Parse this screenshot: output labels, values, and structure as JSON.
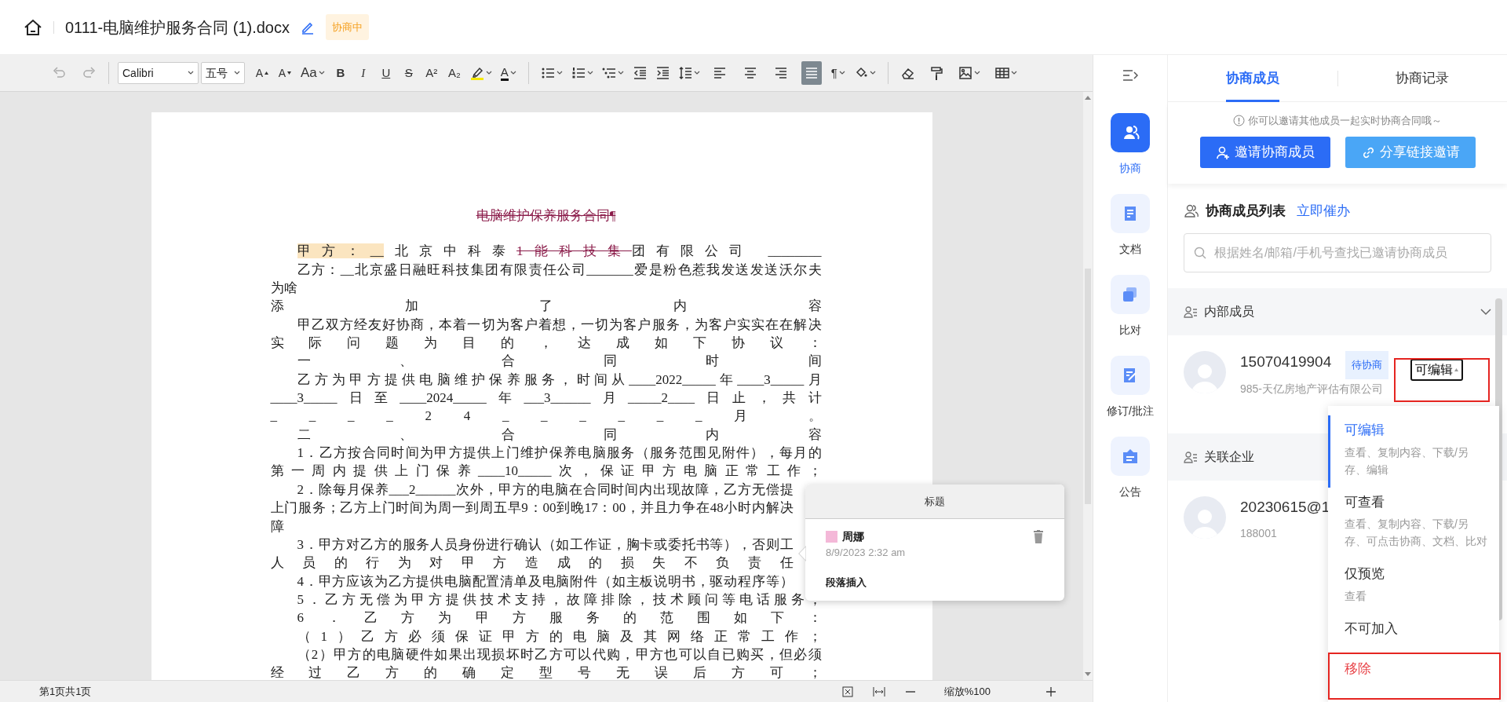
{
  "header": {
    "title": "0111-电脑维护服务合同 (1).docx",
    "status": "协商中"
  },
  "toolbar": {
    "history": [
      {
        "kind": "undo",
        "disabled": true
      },
      {
        "kind": "redo",
        "disabled": true
      }
    ],
    "font": "Calibri",
    "size": "五号",
    "text_tools": [
      {
        "kind": "grow",
        "text": "A"
      },
      {
        "kind": "shrink",
        "text": "A"
      },
      {
        "kind": "case",
        "text": "Aa",
        "dropdown": true
      },
      {
        "kind": "bold",
        "text": "B"
      },
      {
        "kind": "italic",
        "text": "I"
      },
      {
        "kind": "underline",
        "text": "U"
      },
      {
        "kind": "strike",
        "text": "S"
      },
      {
        "kind": "superscript",
        "text": "A²"
      },
      {
        "kind": "subscript",
        "text": "A₂"
      },
      {
        "kind": "highlight",
        "dropdown": true
      },
      {
        "kind": "color",
        "text": "A",
        "dropdown": true
      }
    ],
    "list_tools": [
      {
        "kind": "bullets",
        "dropdown": true
      },
      {
        "kind": "numbering",
        "dropdown": true
      },
      {
        "kind": "multilevel",
        "dropdown": true
      },
      {
        "kind": "outdent"
      },
      {
        "kind": "indent"
      },
      {
        "kind": "spacing",
        "dropdown": true
      }
    ],
    "alignment": [
      {
        "kind": "left",
        "selected": false
      },
      {
        "kind": "center",
        "selected": false
      },
      {
        "kind": "right",
        "selected": false
      },
      {
        "kind": "justify",
        "selected": true
      }
    ],
    "other_tools": [
      {
        "kind": "pilcrow",
        "text": "¶",
        "dropdown": true
      },
      {
        "kind": "fill",
        "dropdown": true
      }
    ],
    "insert_tools": [
      {
        "kind": "eraser"
      },
      {
        "kind": "painter"
      },
      {
        "kind": "image",
        "dropdown": true
      },
      {
        "kind": "table",
        "dropdown": true
      }
    ]
  },
  "document": {
    "lines": [
      {
        "centered": true,
        "segments": [
          {
            "text": "电脑维护保养服务合同¶",
            "kind": "deleted"
          }
        ]
      },
      {
        "indent": true,
        "spread": true,
        "segments": [
          {
            "text": "甲方：__",
            "kind": "highlight"
          },
          {
            "text": "北京中科泰",
            "kind": "plain"
          },
          {
            "text": "1能科技集",
            "kind": "deleted"
          },
          {
            "text": "团有限公司 ________",
            "kind": "plain"
          }
        ]
      },
      {
        "indent": true,
        "spread": true,
        "text": "乙方：__北京盛日融旺科技集团有限责任公司_______爱是粉色惹我发送发送沃尔夫"
      },
      {
        "text": "为啥"
      },
      {
        "spread": true,
        "text": "添加了内容"
      },
      {
        "indent": true,
        "spread": true,
        "text": "甲乙双方经友好协商，本着一切为客户着想，一切为客户服务，为客户实实在在解决"
      },
      {
        "spread": true,
        "text": "实际问题为目的，达成如下协议："
      },
      {
        "indent": true,
        "spread": true,
        "text": "一、合同时间"
      },
      {
        "indent": true,
        "spread": true,
        "text": "乙方为甲方提供电脑维护保养服务，时间从____2022_____年____3_____月"
      },
      {
        "spread": true,
        "text": "____3_____日至____2024_____年___3______月_____2____日止，共计"
      },
      {
        "spread": true,
        "text": "_ _ _ _ 2 4 _ _ _ _ _ _ 月 。"
      },
      {
        "indent": true,
        "spread": true,
        "text": "二、合同内容"
      },
      {
        "indent": true,
        "spread": true,
        "text": "1．乙方按合同时间为甲方提供上门维护保养电脑服务（服务范围见附件），每月的"
      },
      {
        "spread": true,
        "text": "第一周内提供上门保养____10_____次，保证甲方电脑正常工作；"
      },
      {
        "indent": true,
        "spread": true,
        "covered": true,
        "text": "2．除每月保养___2______次外，甲方的电脑在合同时间内出现故障，乙方无偿提"
      },
      {
        "spread": true,
        "covered": true,
        "text": "上门服务；乙方上门时间为周一到周五早9：00到晚17：00，并且力争在48小时内解决"
      },
      {
        "text": "障"
      },
      {
        "indent": true,
        "spread": true,
        "covered": true,
        "text": "3．甲方对乙方的服务人员身份进行确认（如工作证，胸卡或委托书等），否则工"
      },
      {
        "spread": true,
        "covered": true,
        "text": "人员的行为对甲方造成的损失不负责任"
      },
      {
        "indent": true,
        "spread": true,
        "covered": true,
        "text": "4．甲方应该为乙方提供电脑配置清单及电脑附件（如主板说明书，驱动程序等）"
      },
      {
        "indent": true,
        "spread": true,
        "text": "5．乙方无偿为甲方提供技术支持，故障排除，技术顾问等电话服务；"
      },
      {
        "indent": true,
        "spread": true,
        "text": "6．乙方为甲方服务的范围如下："
      },
      {
        "indent": true,
        "spread": true,
        "text": "（1）乙方必须保证甲方的电脑及其网络正常工作；"
      },
      {
        "indent": true,
        "spread": true,
        "text": "（2）甲方的电脑硬件如果出现损坏时乙方可以代购，甲方也可以自已购买，但必须"
      },
      {
        "spread": true,
        "text": "经过乙方的确定型号无误后方可；"
      }
    ]
  },
  "comment": {
    "title": "标题",
    "author": "周娜",
    "color": "#f4b8d8",
    "time": "8/9/2023 2:32 am",
    "body": "段落插入"
  },
  "status_bar": {
    "pages": "第1页共1页",
    "zoom": "缩放%100"
  },
  "rail": [
    {
      "kind": "people",
      "label": "协商",
      "selected": true
    },
    {
      "kind": "doc",
      "label": "文档",
      "selected": false
    },
    {
      "kind": "compare",
      "label": "比对",
      "selected": false
    },
    {
      "kind": "revise",
      "label": "修订/批注",
      "selected": false
    },
    {
      "kind": "notice",
      "label": "公告",
      "selected": false
    }
  ],
  "panel": {
    "tabs": [
      {
        "label": "协商成员",
        "selected": true
      },
      {
        "label": "协商记录",
        "selected": false
      }
    ],
    "hint": "你可以邀请其他成员一起实时协商合同哦～",
    "buttons": [
      {
        "kind": "invite",
        "label": "邀请协商成员"
      },
      {
        "kind": "share",
        "label": "分享链接邀请"
      }
    ],
    "list_title": "协商成员列表",
    "urge_link": "立即催办",
    "search": {
      "placeholder": "根据姓名/邮箱/手机号查找已邀请协商成员"
    },
    "sections": [
      {
        "title": "内部成员",
        "expanded": true,
        "members": [
          {
            "name": "15070419904",
            "status": "待协商",
            "permission": "可编辑",
            "detail": "985-天亿房地产评估有限公司"
          }
        ]
      },
      {
        "title": "关联企业",
        "members": [
          {
            "name": "20230615@1",
            "detail": "188001"
          }
        ]
      }
    ],
    "menu": [
      {
        "kind": "option",
        "label": "可编辑",
        "description": "查看、复制内容、下载/另存、编辑",
        "selected": true
      },
      {
        "kind": "option",
        "label": "可查看",
        "description": "查看、复制内容、下载/另存、可点击协商、文档、比对",
        "selected": false
      },
      {
        "kind": "option",
        "label": "仅预览",
        "description": "查看",
        "selected": false
      },
      {
        "kind": "option",
        "label": "不可加入",
        "selected": false
      },
      {
        "kind": "danger",
        "label": "移除",
        "selected": false
      }
    ]
  }
}
